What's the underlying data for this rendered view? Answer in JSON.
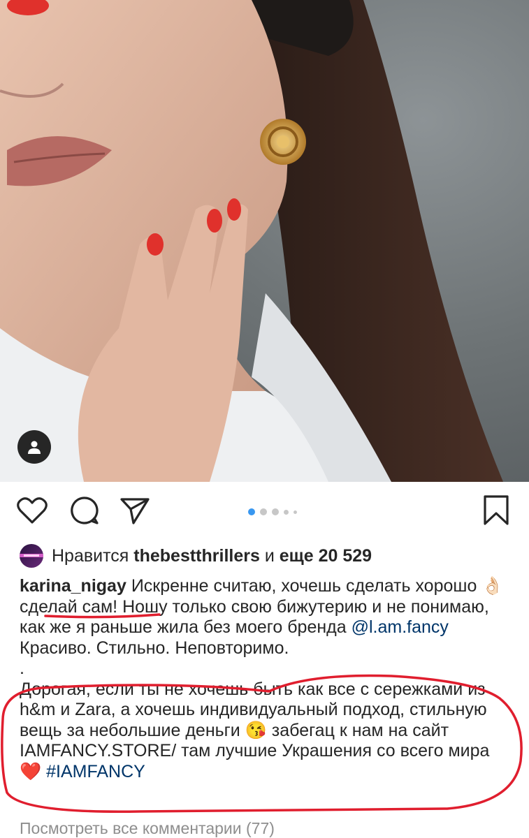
{
  "post": {
    "image_alt": "Woman wearing gold knot earrings",
    "carousel": {
      "current": 1,
      "total": 5
    }
  },
  "actions": {
    "like_icon": "heart-icon",
    "comment_icon": "comment-icon",
    "share_icon": "paper-plane-icon",
    "save_icon": "bookmark-icon"
  },
  "likes": {
    "prefix": "Нравится",
    "user": "thebestthrillers",
    "connector": "и",
    "count_text": "еще 20 529"
  },
  "caption": {
    "author": "karina_nigay",
    "line1_text": "Искренне считаю, хочешь сделать хорошо",
    "ok_emoji": "👌🏻",
    "diy": "сделай сам!",
    "rest1": "Ношу только свою бижутерию и не понимаю, как же я раньше жила без моего бренда",
    "mention": "@l.am.fancy",
    "line2": "Красиво. Стильно. Неповторимо.",
    "dot_line": ".",
    "para3_a": "Дорогая, если ты не хочешь быть как все с сережками из h&m и Zara, а хочешь индивидуальный подход, стильную вещь за небольшие деньги",
    "kiss_emoji": "😘",
    "para3_b": "забегац к нам на сайт IAMFANCY.STORE/ там лучшие Украшения со всего мира",
    "heart_emoji": "❤️",
    "hashtag": "#IAMFANCY"
  },
  "comments": {
    "view_all": "Посмотреть все комментарии (77)"
  },
  "colors": {
    "link": "#003569",
    "annotation": "#e01e2e",
    "carousel_active": "#3897f0"
  }
}
